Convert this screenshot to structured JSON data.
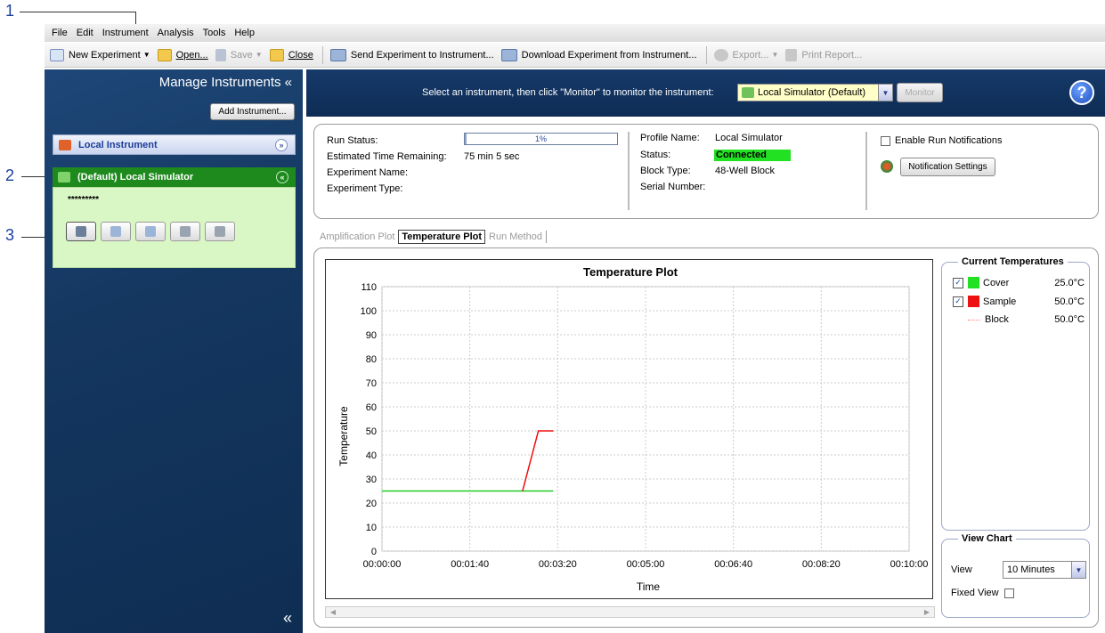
{
  "callouts": [
    "1",
    "2",
    "3"
  ],
  "menu": [
    "File",
    "Edit",
    "Instrument",
    "Analysis",
    "Tools",
    "Help"
  ],
  "toolbar": {
    "new_experiment": "New Experiment",
    "open": "Open...",
    "save": "Save",
    "close": "Close",
    "send": "Send Experiment to Instrument...",
    "download": "Download Experiment from Instrument...",
    "export": "Export...",
    "print": "Print Report..."
  },
  "left_panel": {
    "title": "Manage Instruments «",
    "add_button": "Add Instrument...",
    "local_instrument": "Local Instrument",
    "simulator": "(Default) Local Simulator",
    "password": "*********",
    "collapse": "«"
  },
  "header": {
    "instruction": "Select an instrument, then click \"Monitor\" to monitor the instrument:",
    "selected_instrument": "Local Simulator (Default)",
    "monitor_button": "Monitor",
    "help": "?"
  },
  "status": {
    "run_status_label": "Run Status:",
    "progress": "1%",
    "progress_value": 0.01,
    "time_remaining_label": "Estimated Time Remaining:",
    "time_remaining": "75 min 5 sec",
    "experiment_name_label": "Experiment Name:",
    "experiment_type_label": "Experiment Type:",
    "profile_name_label": "Profile Name:",
    "profile_name": "Local Simulator",
    "status_label": "Status:",
    "status_value": "Connected",
    "block_type_label": "Block Type:",
    "block_type": "48-Well Block",
    "serial_number_label": "Serial Number:",
    "enable_notifications": "Enable Run Notifications",
    "notification_settings": "Notification Settings"
  },
  "tabs": [
    {
      "label": "Amplification Plot",
      "active": false
    },
    {
      "label": "Temperature Plot",
      "active": true
    },
    {
      "label": "Run Method",
      "active": false
    }
  ],
  "legend": {
    "title": "Current Temperatures",
    "rows": [
      {
        "name": "Cover",
        "value": "25.0°C",
        "color": "#22e022",
        "checked": true
      },
      {
        "name": "Sample",
        "value": "50.0°C",
        "color": "#ee1111",
        "checked": true
      },
      {
        "name": "Block",
        "value": "50.0°C",
        "color": "#ff8080",
        "checked": false
      }
    ]
  },
  "view_chart": {
    "title": "View Chart",
    "view_label": "View",
    "view_value": "10 Minutes",
    "fixed_view_label": "Fixed View"
  },
  "chart_data": {
    "type": "line",
    "title": "Temperature Plot",
    "xlabel": "Time",
    "ylabel": "Temperature",
    "xlim": [
      0,
      600
    ],
    "ylim": [
      0,
      110
    ],
    "x_tick_labels": [
      "00:00:00",
      "00:01:40",
      "00:03:20",
      "00:05:00",
      "00:06:40",
      "00:08:20",
      "00:10:00"
    ],
    "y_ticks": [
      0,
      10,
      20,
      30,
      40,
      50,
      60,
      70,
      80,
      90,
      100,
      110
    ],
    "grid": true,
    "series": [
      {
        "name": "Cover",
        "color": "#22cc22",
        "x": [
          0,
          195
        ],
        "y": [
          25,
          25
        ]
      },
      {
        "name": "Sample",
        "color": "#ee1111",
        "x": [
          160,
          178,
          195
        ],
        "y": [
          25,
          50,
          50
        ]
      }
    ]
  }
}
